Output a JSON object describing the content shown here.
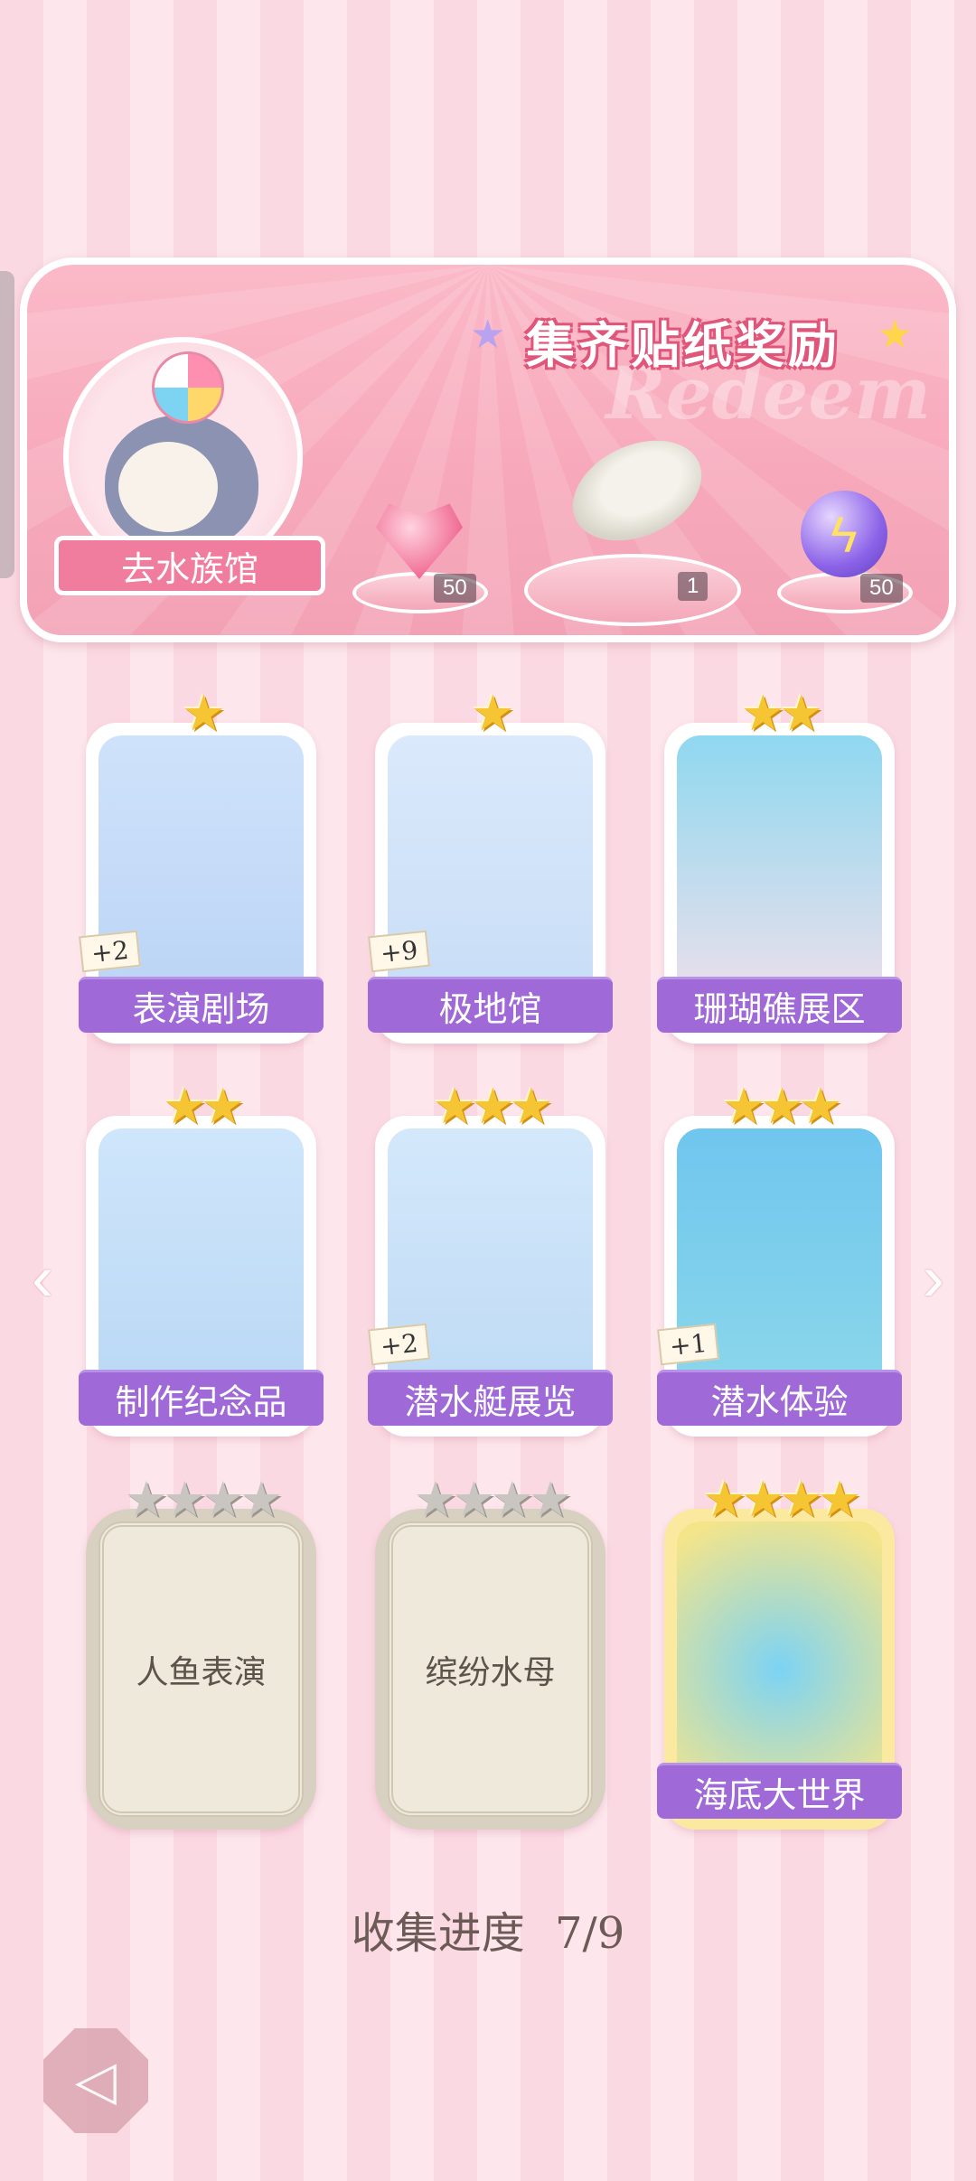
{
  "banner": {
    "title": "集齐贴纸奖励",
    "watermark": "Redeem",
    "go_button": "去水族馆",
    "rewards": [
      {
        "icon": "heart-gem-icon",
        "count": "50"
      },
      {
        "icon": "sun-hat-icon",
        "count": "1"
      },
      {
        "icon": "lightning-orb-icon",
        "count": "50"
      }
    ]
  },
  "cards": [
    {
      "label": "表演剧场",
      "stars": 1,
      "badge": "+2",
      "unlocked": true,
      "art": "seal-with-ball"
    },
    {
      "label": "极地馆",
      "stars": 1,
      "badge": "+9",
      "unlocked": true,
      "art": "polar-bear"
    },
    {
      "label": "珊瑚礁展区",
      "stars": 2,
      "badge": "",
      "unlocked": true,
      "art": "coral-reef"
    },
    {
      "label": "制作纪念品",
      "stars": 2,
      "badge": "",
      "unlocked": true,
      "art": "bottle"
    },
    {
      "label": "潜水艇展览",
      "stars": 3,
      "badge": "+2",
      "unlocked": true,
      "art": "submarine"
    },
    {
      "label": "潜水体验",
      "stars": 3,
      "badge": "+1",
      "unlocked": true,
      "art": "diver-girl"
    },
    {
      "label": "人鱼表演",
      "stars": 4,
      "badge": "",
      "unlocked": false,
      "art": ""
    },
    {
      "label": "缤纷水母",
      "stars": 4,
      "badge": "",
      "unlocked": false,
      "art": ""
    },
    {
      "label": "海底大世界",
      "stars": 4,
      "badge": "",
      "unlocked": true,
      "art": "whale"
    }
  ],
  "progress": {
    "label": "收集进度",
    "value": "7/9"
  },
  "colors": {
    "accent": "#9f6ad8",
    "banner": "#f7a9bb",
    "star": "#f6c534"
  }
}
